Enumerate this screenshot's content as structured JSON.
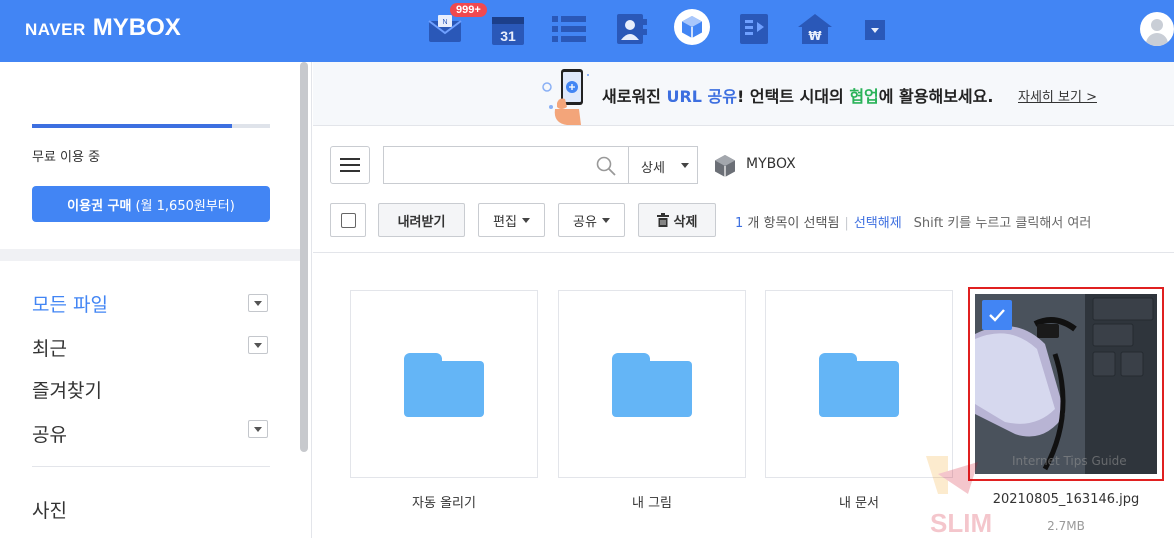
{
  "header": {
    "logo_naver": "NAVER",
    "logo_mybox": "MYBOX",
    "mail_badge": "999+",
    "calendar_date": "31",
    "apps": [
      "mail-icon",
      "calendar-icon",
      "list-icon",
      "contacts-icon",
      "mybox-icon",
      "memo-icon",
      "pay-icon",
      "more-apps-icon"
    ]
  },
  "sidebar": {
    "usage_percent": 84,
    "free_label": "무료 이용 중",
    "buy_button_bold": "이용권 구매",
    "buy_button_sub": "(월 1,650원부터)",
    "nav": [
      {
        "label": "모든 파일",
        "active": true,
        "has_caret": true
      },
      {
        "label": "최근",
        "active": false,
        "has_caret": true
      },
      {
        "label": "즐겨찾기",
        "active": false,
        "has_caret": false
      },
      {
        "label": "공유",
        "active": false,
        "has_caret": true
      }
    ],
    "photos_label": "사진"
  },
  "banner": {
    "text_1": "새로워진 ",
    "text_url": "URL 공유",
    "text_2": "! 언택트 시대의 ",
    "text_collab": "협업",
    "text_3": "에 활용해보세요.",
    "more_label": "자세히 보기 >"
  },
  "toolbar": {
    "search_placeholder": "",
    "detail_label": "상세",
    "breadcrumb": "MYBOX",
    "download_label": "내려받기",
    "edit_label": "편집",
    "share_label": "공유",
    "delete_label": "삭제",
    "selected_count": "1",
    "selected_text": "개 항목이 선택됨",
    "clear_label": "선택해제",
    "hint_text": "Shift 키를 누르고 클릭해서 여러"
  },
  "files": [
    {
      "name": "자동 올리기",
      "type": "folder"
    },
    {
      "name": "내 그림",
      "type": "folder"
    },
    {
      "name": "내 문서",
      "type": "folder"
    },
    {
      "name": "20210805_163146.jpg",
      "type": "image",
      "size": "2.7MB",
      "selected": true
    }
  ],
  "photo_watermark": "Internet Tips Guide",
  "colors": {
    "brand": "#4285f4",
    "selected_border": "#e02020",
    "folder": "#64b5f6"
  }
}
